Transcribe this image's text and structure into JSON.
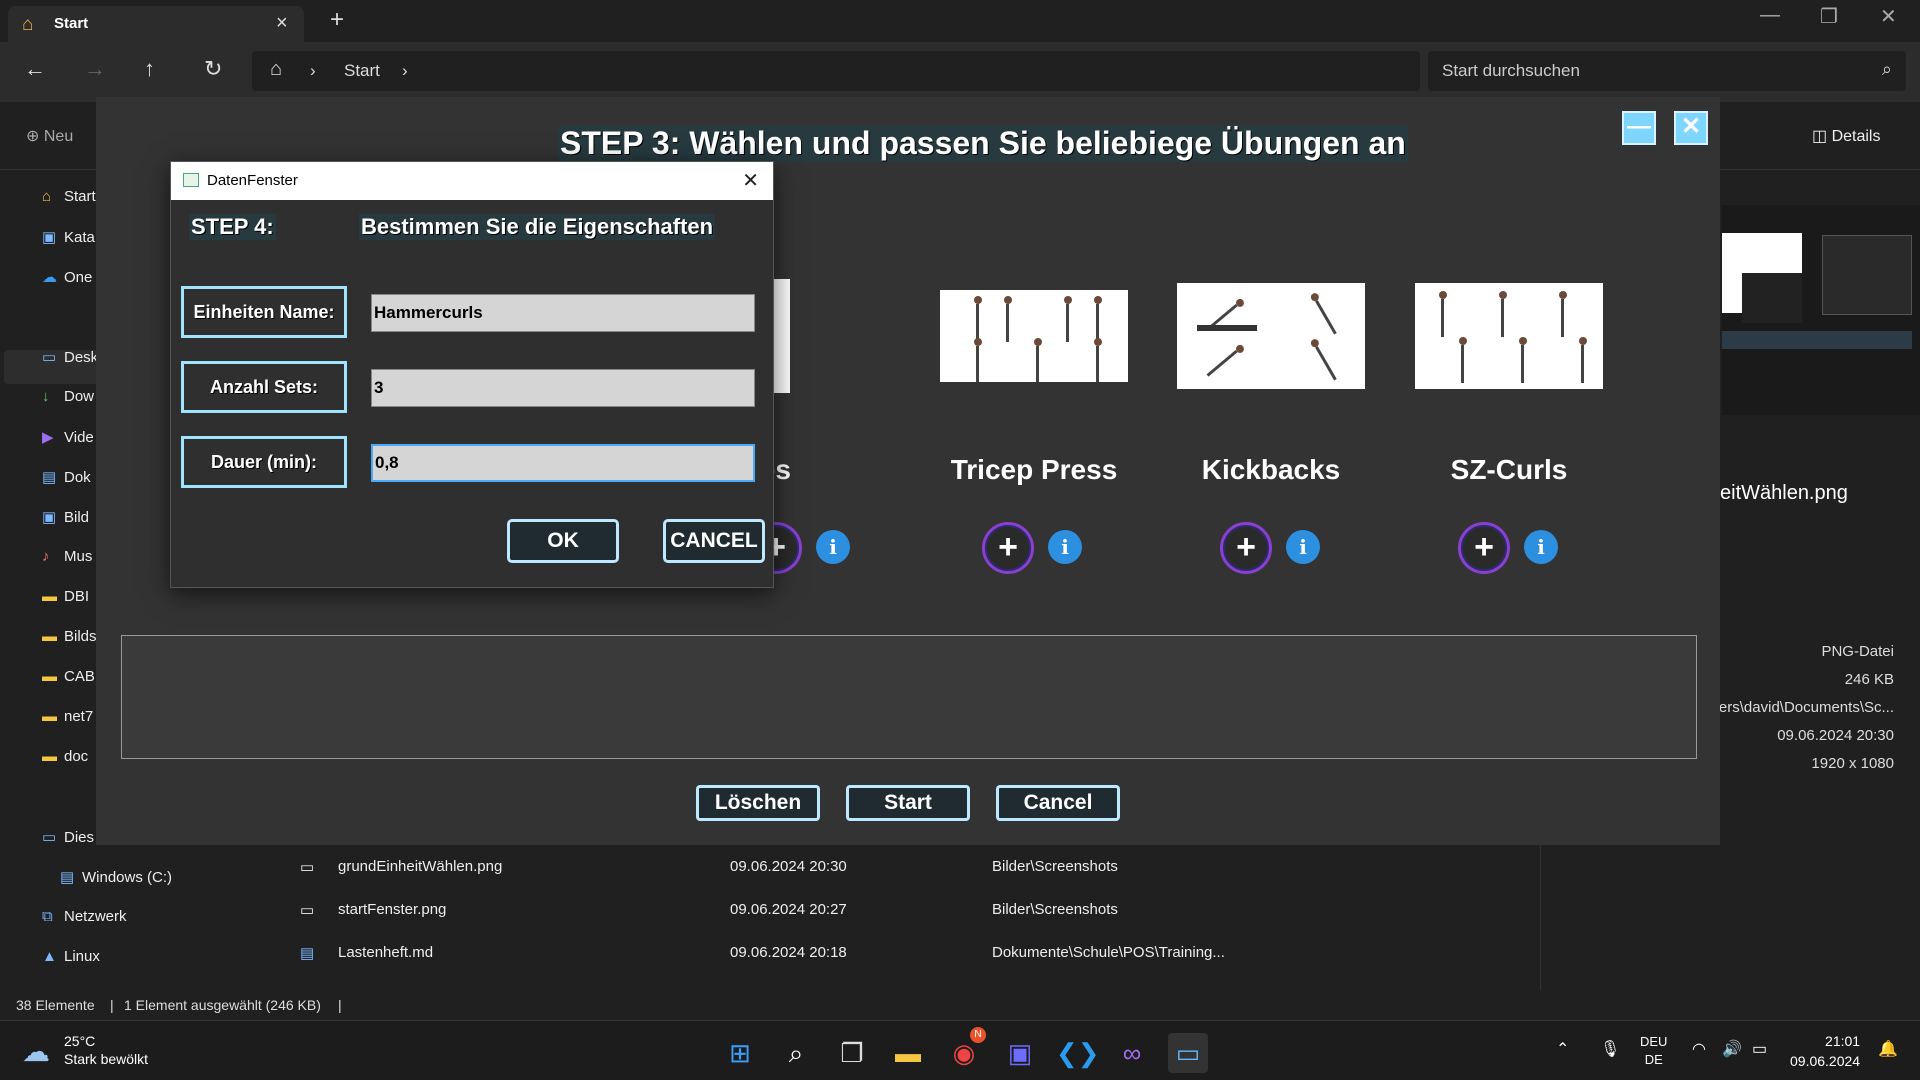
{
  "explorer": {
    "tab_label": "Start",
    "address": {
      "crumb": "Start"
    },
    "search_placeholder": "Start durchsuchen",
    "new_label": "Neu",
    "details_label": "Details",
    "sidebar": [
      {
        "label": "Start",
        "icon": "home-icon"
      },
      {
        "label": "Kata",
        "icon": "gallery-icon"
      },
      {
        "label": "One",
        "icon": "cloud-icon"
      },
      {
        "label": "Desk",
        "icon": "desktop-icon"
      },
      {
        "label": "Dow",
        "icon": "download-icon"
      },
      {
        "label": "Vide",
        "icon": "video-icon"
      },
      {
        "label": "Dok",
        "icon": "document-icon"
      },
      {
        "label": "Bild",
        "icon": "pictures-icon"
      },
      {
        "label": "Mus",
        "icon": "music-icon"
      },
      {
        "label": "DBI",
        "icon": "folder-icon"
      },
      {
        "label": "Bilds",
        "icon": "folder-icon"
      },
      {
        "label": "CAB",
        "icon": "folder-icon"
      },
      {
        "label": "net7",
        "icon": "folder-icon"
      },
      {
        "label": "doc",
        "icon": "folder-icon"
      },
      {
        "label": "Dies",
        "icon": "pc-icon"
      },
      {
        "label": "Windows (C:)",
        "icon": "drive-icon"
      },
      {
        "label": "Netzwerk",
        "icon": "network-icon"
      },
      {
        "label": "Linux",
        "icon": "linux-icon"
      }
    ],
    "files": [
      {
        "name": "grundEinheitWählen.png",
        "date": "09.06.2024 20:30",
        "location": "Bilder\\Screenshots"
      },
      {
        "name": "startFenster.png",
        "date": "09.06.2024 20:27",
        "location": "Bilder\\Screenshots"
      },
      {
        "name": "Lastenheft.md",
        "date": "09.06.2024 20:18",
        "location": "Dokumente\\Schule\\POS\\Training..."
      }
    ],
    "details_pane": {
      "filename": "eitWählen.png",
      "type": "PNG-Datei",
      "size": "246 KB",
      "path": "ers\\david\\Documents\\Sc...",
      "date": "09.06.2024 20:30",
      "dimensions": "1920 x 1080"
    },
    "status": {
      "count": "38 Elemente",
      "sep": "|",
      "selection": "1 Element ausgewählt (246 KB)",
      "sep2": "|"
    }
  },
  "taskbar": {
    "weather_temp": "25°C",
    "weather_desc": "Stark bewölkt",
    "lang_top": "DEU",
    "lang_bottom": "DE",
    "time": "21:01",
    "date": "09.06.2024",
    "chrome_badge": "N"
  },
  "app": {
    "title": "STEP 3: Wählen und passen Sie beliebiege Übungen an",
    "minimize": "—",
    "close": "✕",
    "cards": [
      {
        "name": "sh-Ups"
      },
      {
        "name": "Tricep Press"
      },
      {
        "name": "Kickbacks"
      },
      {
        "name": "SZ-Curls"
      }
    ],
    "plus_symbol": "+",
    "info_symbol": "i",
    "buttons": {
      "delete": "Löschen",
      "start": "Start",
      "cancel": "Cancel"
    }
  },
  "dialog": {
    "title": "DatenFenster",
    "step": "STEP 4:",
    "subtitle": "Bestimmen Sie die Eigenschaften",
    "fields": {
      "name_label": "Einheiten Name:",
      "name_value": "Hammercurls",
      "sets_label": "Anzahl Sets:",
      "sets_value": "3",
      "duration_label": "Dauer (min):",
      "duration_value": "0,8"
    },
    "ok": "OK",
    "cancel": "CANCEL"
  },
  "colors": {
    "accent_border": "#bde9ff",
    "plus_ring": "#8a3fd1",
    "info_blue": "#2c8fe0",
    "title_bg": "#263a3f"
  }
}
